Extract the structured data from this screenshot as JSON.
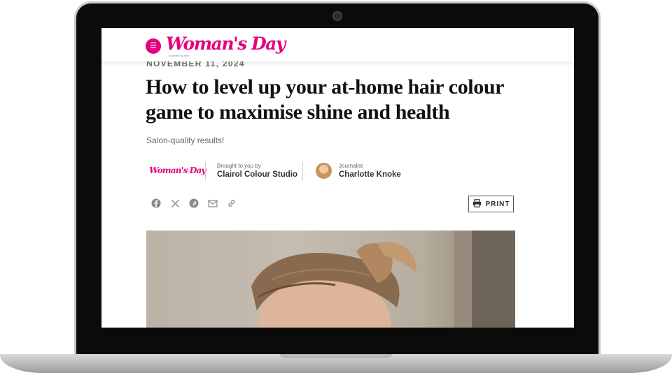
{
  "header": {
    "menu_icon": "hamburger-icon",
    "logo_text": "Woman's Day",
    "logo_tag": "powered by 9pm"
  },
  "article": {
    "date": "NOVEMBER 11, 2024",
    "title": "How to level up your at-home hair colour game to maximise shine and health",
    "subtitle": "Salon-quality results!"
  },
  "byline": {
    "brand_logo": "Woman's Day",
    "brought_label": "Brought to you by",
    "brought_value": "Clairol Colour Studio",
    "journalist_label": "Journalist",
    "journalist_name": "Charlotte Knoke"
  },
  "share": {
    "icons": [
      "facebook-icon",
      "x-icon",
      "pinterest-icon",
      "email-icon",
      "link-icon"
    ],
    "print_label": "PRINT"
  },
  "colors": {
    "brand": "#e5007e",
    "title": "#111111",
    "meta": "#6d6d6d"
  }
}
